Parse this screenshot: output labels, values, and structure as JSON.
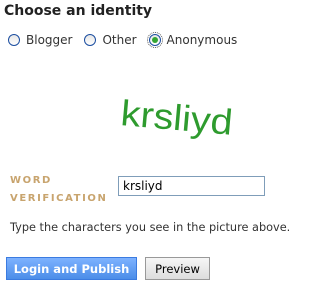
{
  "identity": {
    "heading": "Choose an identity",
    "options": [
      {
        "label": "Blogger",
        "checked": false
      },
      {
        "label": "Other",
        "checked": false
      },
      {
        "label": "Anonymous",
        "checked": true
      }
    ]
  },
  "verification": {
    "captcha_text": "krsliyd",
    "captcha_color": "#2e9b2e",
    "label": "WORD\nVERIFICATION",
    "input_value": "krsliyd",
    "hint": "Type the characters you see in the picture above."
  },
  "buttons": {
    "publish_label": "Login and Publish",
    "preview_label": "Preview"
  },
  "colors": {
    "radio_checked": "#33a533",
    "label_tan": "#c8a46e",
    "primary_button": "#5b9af2"
  }
}
